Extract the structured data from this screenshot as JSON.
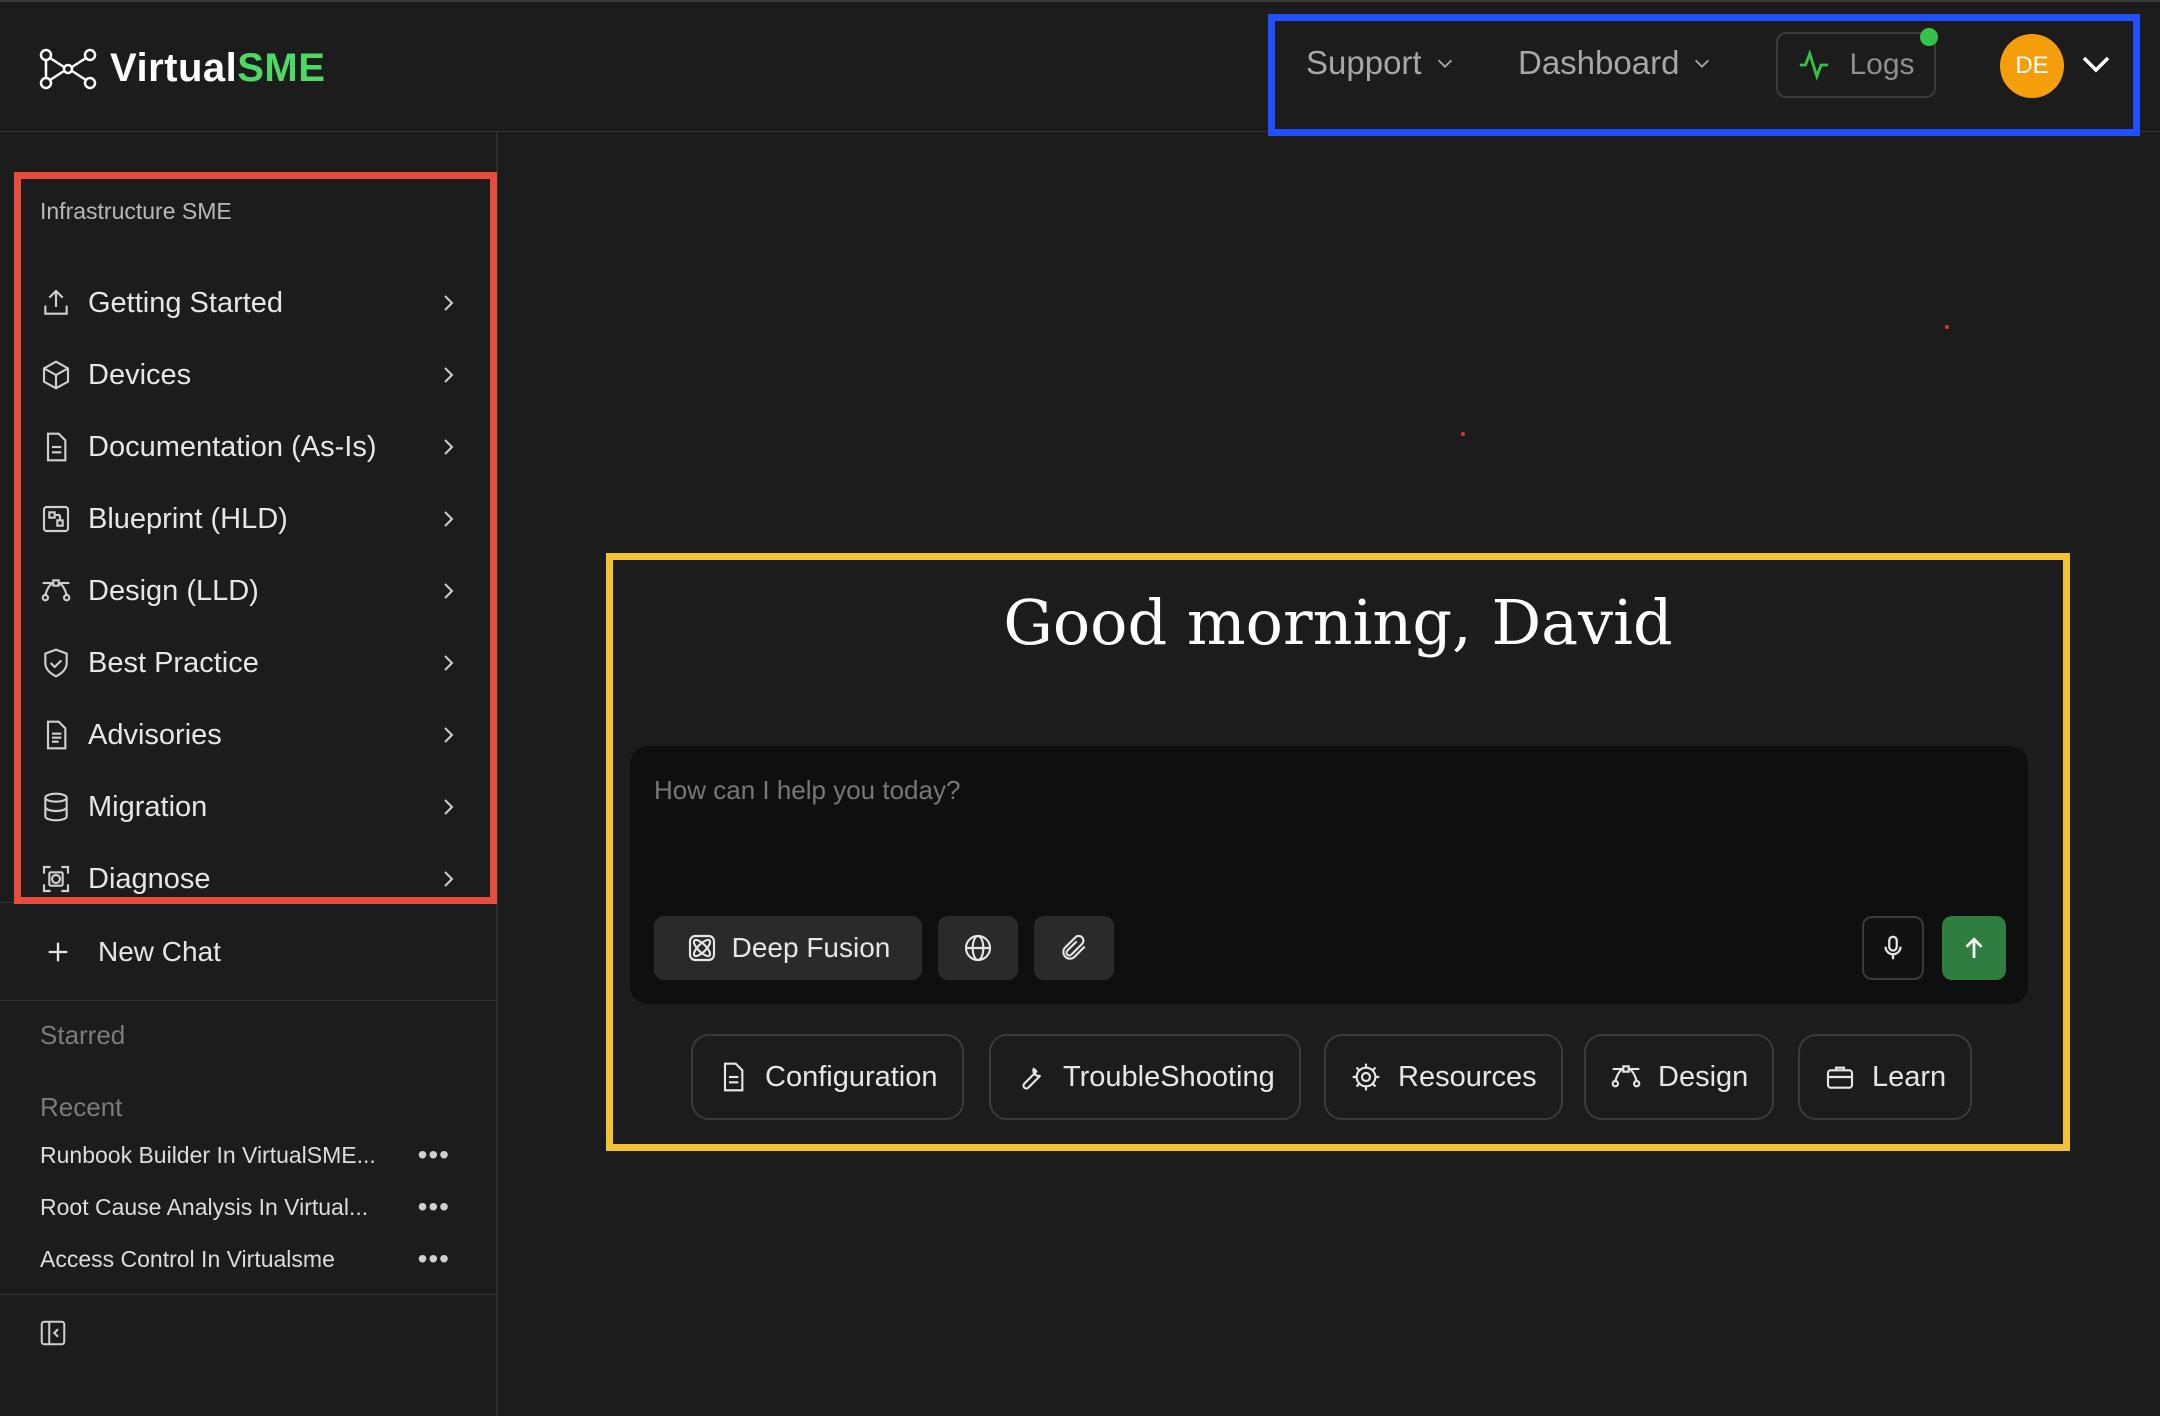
{
  "brand": {
    "name_part1": "Virtual",
    "name_part2": "SME",
    "accent_color": "#4cd964"
  },
  "header": {
    "nav": [
      {
        "label": "Support",
        "icon": "chevron-down-icon"
      },
      {
        "label": "Dashboard",
        "icon": "chevron-down-icon"
      }
    ],
    "logs": {
      "label": "Logs",
      "icon": "activity-icon",
      "status_color": "#35c24a"
    },
    "user": {
      "initials": "DE",
      "avatar_color": "#f59e0b"
    }
  },
  "sidebar": {
    "section_title": "Infrastructure SME",
    "items": [
      {
        "label": "Getting Started",
        "icon": "upload-icon"
      },
      {
        "label": "Devices",
        "icon": "cube-icon"
      },
      {
        "label": "Documentation (As-Is)",
        "icon": "document-icon"
      },
      {
        "label": "Blueprint (HLD)",
        "icon": "blueprint-icon"
      },
      {
        "label": "Design (LLD)",
        "icon": "bezier-icon"
      },
      {
        "label": "Best Practice",
        "icon": "handshake-shield-icon"
      },
      {
        "label": "Advisories",
        "icon": "document-icon"
      },
      {
        "label": "Migration",
        "icon": "database-icon"
      },
      {
        "label": "Diagnose",
        "icon": "scan-gear-icon"
      }
    ],
    "new_chat": "New Chat",
    "starred_label": "Starred",
    "recent_label": "Recent",
    "recent": [
      {
        "title": "Runbook Builder In VirtualSME..."
      },
      {
        "title": "Root Cause Analysis In Virtual..."
      },
      {
        "title": "Access Control In Virtualsme"
      }
    ]
  },
  "main": {
    "greeting": "Good morning, David",
    "composer": {
      "placeholder": "How can I help you today?",
      "deep_fusion": "Deep Fusion"
    },
    "quick_actions": [
      {
        "label": "Configuration",
        "icon": "document-icon"
      },
      {
        "label": "TroubleShooting",
        "icon": "wrench-icon"
      },
      {
        "label": "Resources",
        "icon": "gear-icon"
      },
      {
        "label": "Design",
        "icon": "bezier-icon"
      },
      {
        "label": "Learn",
        "icon": "briefcase-icon"
      }
    ],
    "send_color": "#2f7d40"
  }
}
